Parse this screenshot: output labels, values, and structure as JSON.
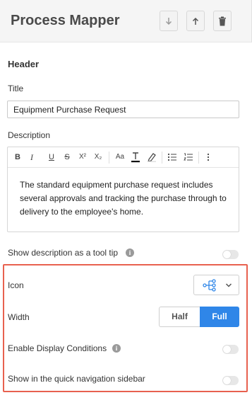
{
  "app": {
    "title": "Process Mapper"
  },
  "header": {
    "section_title": "Header",
    "title_label": "Title",
    "title_value": "Equipment Purchase Request",
    "description_label": "Description",
    "description_text": "The standard equipment purchase request includes several approvals and tracking the purchase through to delivery to the employee's home."
  },
  "editor_toolbar": {
    "bold": "B",
    "italic": "I",
    "underline": "U",
    "strike": "S",
    "superscript": "X²",
    "subscript": "X₂",
    "font_size": "Aa"
  },
  "settings": {
    "show_tooltip_label": "Show description as a tool tip",
    "show_tooltip_on": false,
    "icon_label": "Icon",
    "icon_selected": "flow-icon",
    "width_label": "Width",
    "width_options": [
      "Half",
      "Full"
    ],
    "width_selected": "Full",
    "display_conditions_label": "Enable Display Conditions",
    "display_conditions_on": false,
    "quick_nav_label": "Show in the quick navigation sidebar",
    "quick_nav_on": false
  },
  "colors": {
    "accent": "#2f86e8",
    "highlight": "#e8614f"
  }
}
